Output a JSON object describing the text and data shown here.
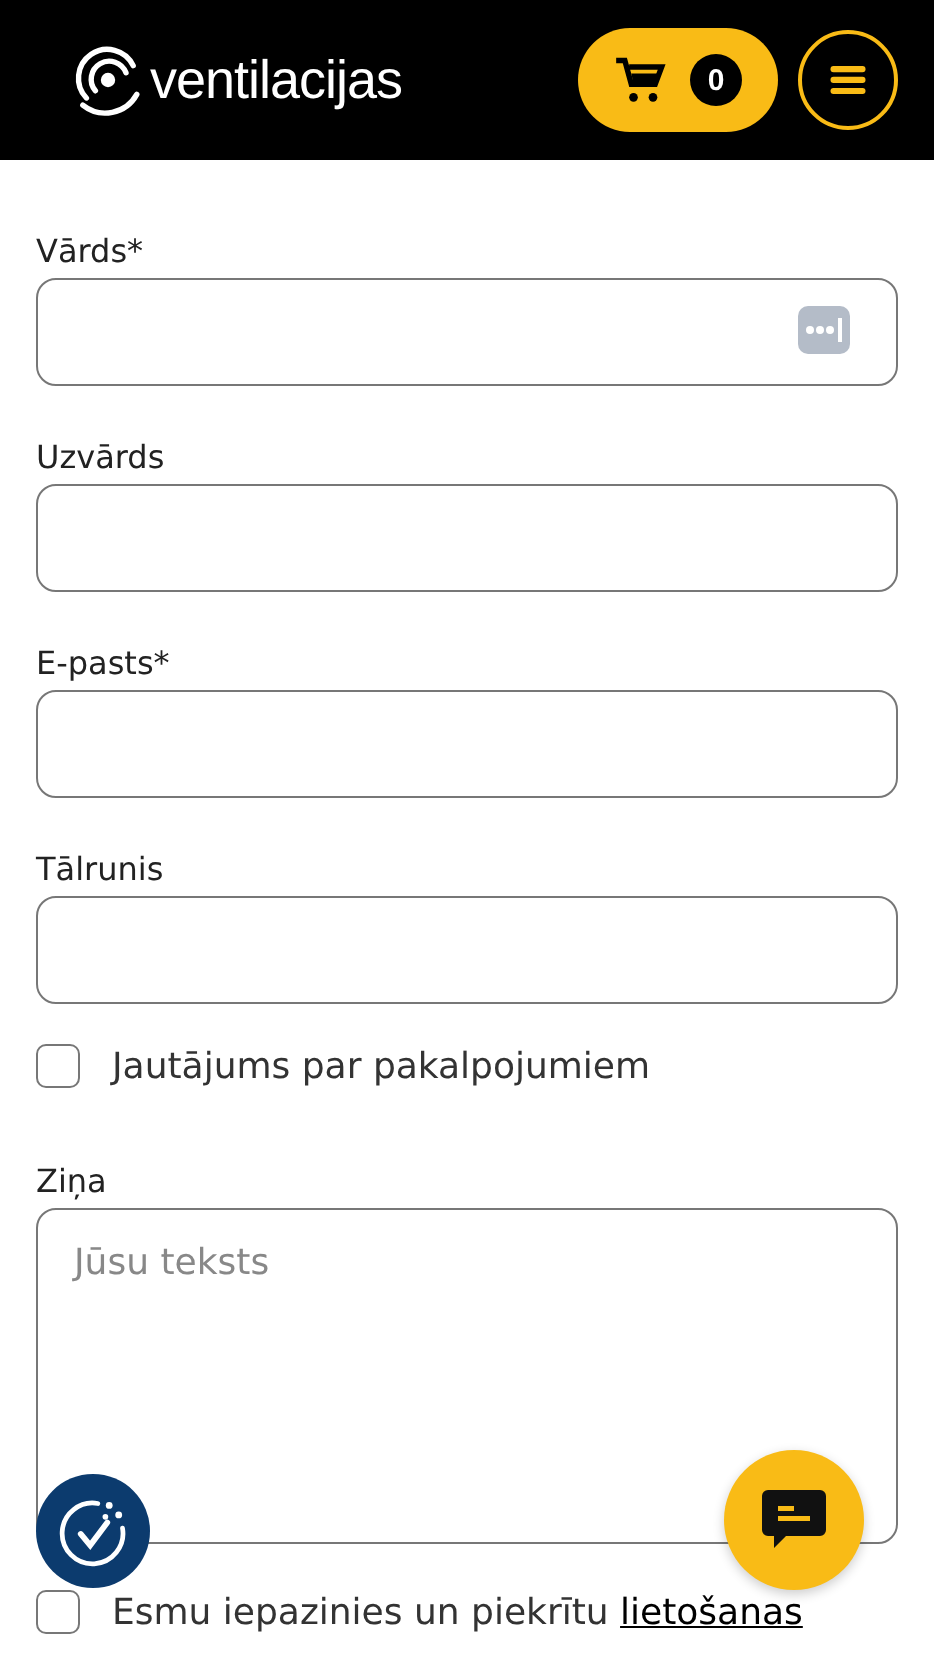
{
  "header": {
    "logo_text": "ventilacijas",
    "cart_count": "0"
  },
  "fields": [
    {
      "label": "Vārds*",
      "kind": "input",
      "password_manager": true
    },
    {
      "label": "Uzvārds",
      "kind": "input"
    },
    {
      "label": "E-pasts*",
      "kind": "input"
    },
    {
      "label": "Tālrunis",
      "kind": "input"
    }
  ],
  "service_question": {
    "label": "Jautājums par pakalpojumiem",
    "checked": false
  },
  "message": {
    "label": "Ziņa",
    "placeholder": "Jūsu teksts"
  },
  "consent": {
    "text": "Esmu iepazinies un piekrītu ",
    "link": "lietošanas",
    "checked": false
  }
}
